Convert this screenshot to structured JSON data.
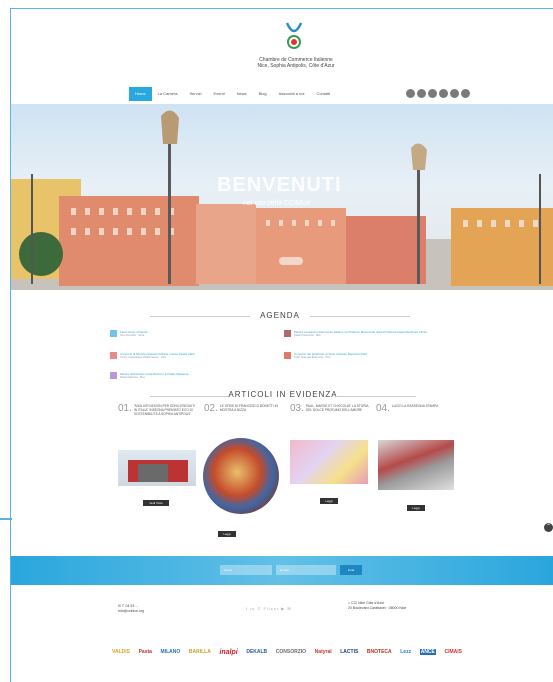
{
  "header": {
    "brand_line1": "Chambre de Commerce Italienne",
    "brand_line2": "Nice, Sophia Antipolis, Côte d'Azur",
    "nav": [
      "Home",
      "La Camera",
      "Servizi",
      "Eventi",
      "News",
      "Blog",
      "Associati a noi",
      "Contatti"
    ],
    "social_icons": [
      "facebook-icon",
      "twitter-icon",
      "linkedin-icon",
      "googleplus-icon",
      "youtube-icon",
      "rss-icon"
    ]
  },
  "hero": {
    "title": "BENVENUTI",
    "subtitle": "nel sito della CCIMice"
  },
  "agenda": {
    "title": "AGENDA",
    "items": [
      {
        "text": "Fiera Verso il Mondo",
        "meta": "Nice Acropolis · Nizza",
        "color": "#6fc3e8"
      },
      {
        "text": "Mostra Leopardi il Patrimonio Italiano nel Palazzo Marecciale della Prefettura Alpes-Maritimes Nizza",
        "meta": "Palais Préfectoral · Nice",
        "color": "#b06a6a"
      },
      {
        "text": "Concerto di Musica Classica Italiana presso Palais Italia",
        "meta": "Centre Universitaire Méditerranéen · Nice",
        "color": "#e88a8a"
      },
      {
        "text": "Concerto del Quartetto di Cielo di Reste Marimba 2016",
        "meta": "CUM, Quai des États-Unis · Nice",
        "color": "#e07a6a"
      },
      {
        "text": "Mostra dell'Artista Costa Roberto a Palais Masséna",
        "meta": "Palais Masséna · Nice",
        "color": "#b79ad8"
      }
    ]
  },
  "articles": {
    "title": "ARTICOLI IN EVIDENZA",
    "items": [
      {
        "num": "01.",
        "title": "\"MIGLIOR DESIGN PER SONO ESEGUITI IN ITALIA\" INSEGNA PREMIATO ECO DI SOSTENIBILITÀ A SOPHIA ANTIPOLIS",
        "button": "Vedi Tutto"
      },
      {
        "num": "02.",
        "title": "LE SFIDE DI FRANCESCO BONETTI IN MOSTRA A NIZZA",
        "button": "Leggi"
      },
      {
        "num": "03.",
        "title": "PAUL, MARGE ET CHOCOLAT: LA STORIA DEL DOLCE PROFUMO DELL'AMORE",
        "button": "Leggi"
      },
      {
        "num": "04.",
        "title": "LUCIO LA RASSEGNA STAMPA",
        "button": "Leggi"
      }
    ]
  },
  "newsletter": {
    "name_placeholder": "Nome",
    "email_placeholder": "E-mail",
    "button": "Invia"
  },
  "footer": {
    "phone": "T. 04 93 ...",
    "email": "info@ccinice.org",
    "social_text": "f  in  ©  Flickr  ▶  ✉",
    "address_line1": "CCI Nice Côte d'Azur",
    "address_line2": "20 Boulevard Carabacel · 06000 Nice",
    "sponsors": [
      "VALDIS",
      "Pasta",
      "MILANO",
      "BARILLA",
      "inalpi",
      "DEKALB",
      "CONSORZIO",
      "Natyral",
      "LACTIS",
      "BNOTECA",
      "Lezz",
      "ANCE",
      "CIMAIS"
    ]
  }
}
